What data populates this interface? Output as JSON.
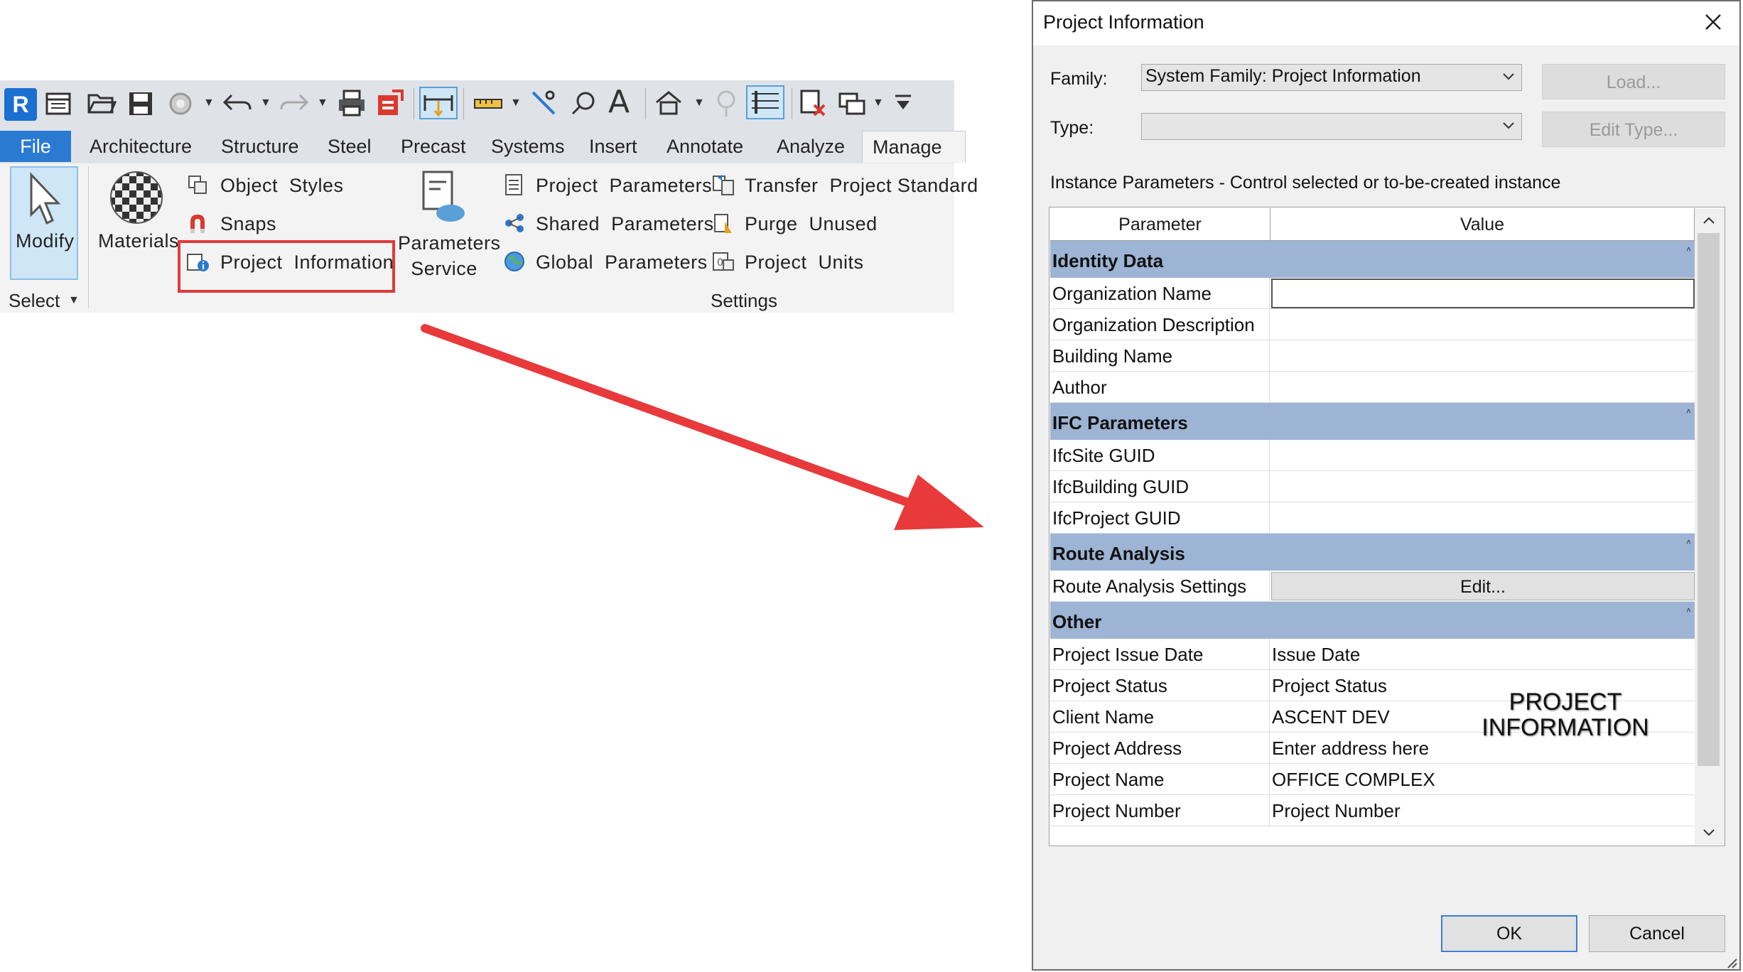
{
  "ribbon": {
    "tabs": [
      "File",
      "Architecture",
      "Structure",
      "Steel",
      "Precast",
      "Systems",
      "Insert",
      "Annotate",
      "Analyze",
      "Manage"
    ],
    "active_tab": "Manage",
    "select_panel": {
      "modify_label": "Modify",
      "select_label": "Select"
    },
    "materials_label": "Materials",
    "object_styles": "Object  Styles",
    "snaps": "Snaps",
    "project_information": "Project  Information",
    "parameters_service": "Parameters\nService",
    "project_parameters": "Project  Parameters",
    "shared_parameters": "Shared  Parameters",
    "global_parameters": "Global  Parameters",
    "transfer_project_standards": "Transfer  Project Standard",
    "purge_unused": "Purge  Unused",
    "project_units": "Project  Units",
    "settings_panel_title": "Settings",
    "icons": [
      "revit-app-icon",
      "recent-files-icon",
      "open-icon",
      "save-icon",
      "sync-icon",
      "undo-icon",
      "redo-icon",
      "print-icon",
      "export-icon",
      "measure-icon",
      "dimension-icon",
      "align-icon",
      "tag-icon",
      "text-icon",
      "3d-view-icon",
      "section-icon",
      "thin-lines-icon",
      "close-hidden-icon",
      "switch-windows-icon",
      "customize-qat-icon"
    ]
  },
  "colors": {
    "file_tab": "#2a7ad2",
    "highlight_box": "#e03a3a",
    "arrow": "#e8393b",
    "group_header": "#9db4d4"
  },
  "dialog": {
    "title": "Project Information",
    "family_label": "Family:",
    "family_value": "System Family: Project Information",
    "type_label": "Type:",
    "type_value": "",
    "load_button": "Load...",
    "edit_type_button": "Edit Type...",
    "instance_params_label": "Instance Parameters - Control selected or to-be-created instance",
    "col_parameter": "Parameter",
    "col_value": "Value",
    "groups": [
      {
        "name": "Identity Data",
        "rows": [
          {
            "param": "Organization Name",
            "value": ""
          },
          {
            "param": "Organization Description",
            "value": ""
          },
          {
            "param": "Building Name",
            "value": ""
          },
          {
            "param": "Author",
            "value": ""
          }
        ]
      },
      {
        "name": "IFC Parameters",
        "rows": [
          {
            "param": "IfcSite GUID",
            "value": ""
          },
          {
            "param": "IfcBuilding GUID",
            "value": ""
          },
          {
            "param": "IfcProject GUID",
            "value": ""
          }
        ]
      },
      {
        "name": "Route Analysis",
        "rows": [
          {
            "param": "Route Analysis Settings",
            "value": "Edit..."
          }
        ]
      },
      {
        "name": "Other",
        "rows": [
          {
            "param": "Project Issue Date",
            "value": "Issue Date"
          },
          {
            "param": "Project Status",
            "value": "Project Status"
          },
          {
            "param": "Client Name",
            "value": "ASCENT DEV"
          },
          {
            "param": "Project Address",
            "value": "Enter address here"
          },
          {
            "param": "Project Name",
            "value": "OFFICE COMPLEX"
          },
          {
            "param": "Project Number",
            "value": "Project Number"
          }
        ]
      }
    ],
    "ok_button": "OK",
    "cancel_button": "Cancel"
  },
  "annotation": "PROJECT\nINFORMATION"
}
